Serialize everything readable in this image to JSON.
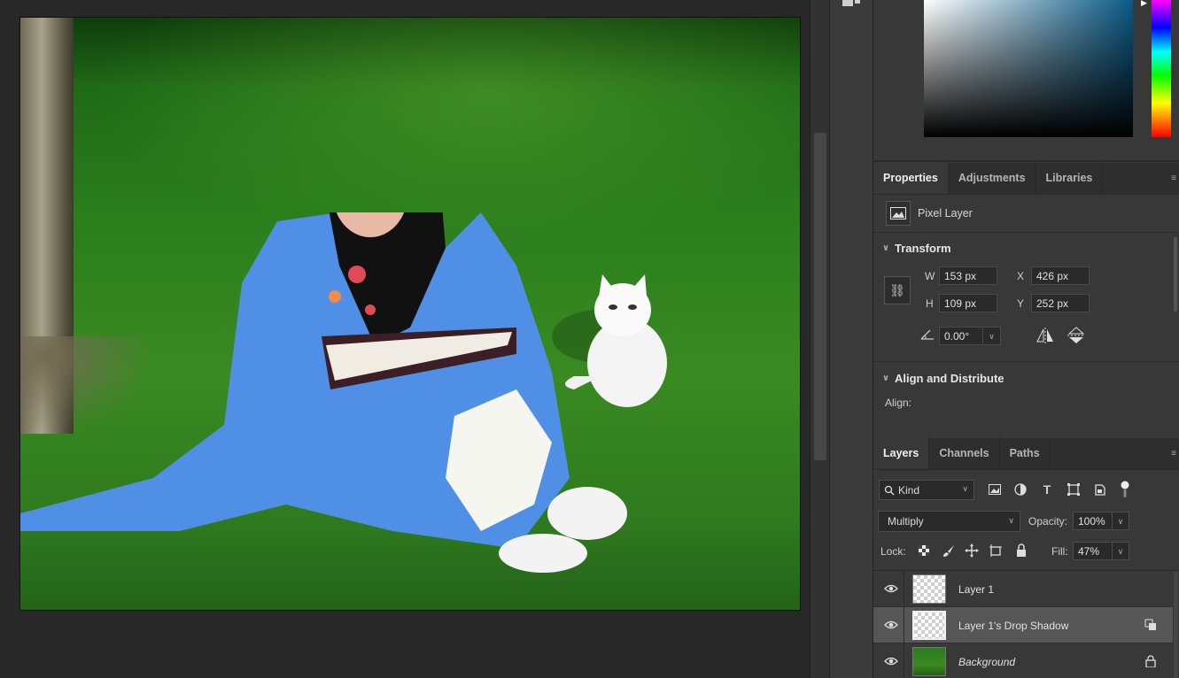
{
  "panels": {
    "properties_tabs": [
      "Properties",
      "Adjustments",
      "Libraries"
    ],
    "layers_tabs": [
      "Layers",
      "Channels",
      "Paths"
    ]
  },
  "properties": {
    "layer_type": "Pixel Layer",
    "transform": {
      "title": "Transform",
      "w_label": "W",
      "w": "153 px",
      "h_label": "H",
      "h": "109 px",
      "x_label": "X",
      "x": "426 px",
      "y_label": "Y",
      "y": "252 px",
      "angle": "0.00°"
    },
    "align": {
      "title": "Align and Distribute",
      "align_label": "Align:"
    }
  },
  "layers_panel": {
    "filter_kind": "Kind",
    "blend_mode": "Multiply",
    "opacity_label": "Opacity:",
    "opacity": "100%",
    "lock_label": "Lock:",
    "fill_label": "Fill:",
    "fill": "47%",
    "layers": [
      {
        "name": "Layer 1",
        "selected": false,
        "italic": false
      },
      {
        "name": "Layer 1's Drop Shadow",
        "selected": true,
        "italic": false
      },
      {
        "name": "Background",
        "selected": false,
        "italic": true
      }
    ]
  },
  "colors": {
    "accent_selected_row": "#565656",
    "panel_bg": "#383838"
  }
}
